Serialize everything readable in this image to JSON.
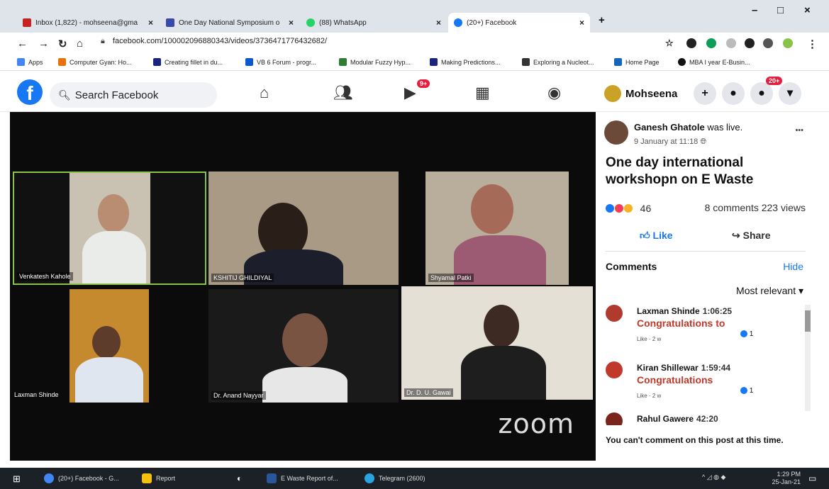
{
  "browser": {
    "tabs": [
      {
        "label": "Inbox (1,822) - mohseena@gma",
        "color": "#c5221f"
      },
      {
        "label": "One Day National Symposium o",
        "color": "#3949ab"
      },
      {
        "label": "(88) WhatsApp",
        "color": "#25d366"
      },
      {
        "label": "(20+) Facebook",
        "color": "#1877f2"
      }
    ],
    "new_tab": "+",
    "window": {
      "minimize": "–",
      "maximize": "□",
      "close": "×"
    },
    "url": "facebook.com/100002096880343/videos/3736471776432682/",
    "bookmarks": [
      {
        "label": "Apps",
        "color": "#4285f4"
      },
      {
        "label": "Computer Gyan: Ho...",
        "color": "#e8710a"
      },
      {
        "label": "Creating fillet in du...",
        "color": "#1a237e"
      },
      {
        "label": "VB 6 Forum - progr...",
        "color": "#0b57d0"
      },
      {
        "label": "Modular Fuzzy Hyp...",
        "color": "#2e7d32"
      },
      {
        "label": "Making Predictions...",
        "color": "#1a237e"
      },
      {
        "label": "Exploring a Nucleot...",
        "color": "#333333"
      },
      {
        "label": "Home Page",
        "color": "#1565c0"
      },
      {
        "label": "MBA I year E-Busin...",
        "color": "#111111"
      }
    ]
  },
  "facebook": {
    "search_placeholder": "Search Facebook",
    "watch_badge": "9+",
    "notif_badge": "20+",
    "profile_name": "Mohseena",
    "plus": "+"
  },
  "video": {
    "brand": "zoom",
    "participants": [
      {
        "name": "Venkatesh Kahole"
      },
      {
        "name": "KSHITIJ GHILDIYAL"
      },
      {
        "name": "Shyamal Patki"
      },
      {
        "name": "Laxman Shinde"
      },
      {
        "name": "Dr. Anand Nayyar"
      },
      {
        "name": "Dr. D. U. Gawai"
      }
    ]
  },
  "post": {
    "author": "Ganesh Ghatole",
    "author_suffix": "was live.",
    "time": "9 January at 11:18",
    "title": "One day international workshopn on E Waste",
    "reactions_count": "46",
    "stats": "8 comments 223 views",
    "like_label": "Like",
    "share_label": "Share",
    "more": "•••"
  },
  "comments": {
    "header": "Comments",
    "hide": "Hide",
    "sort": "Most relevant ▾",
    "items": [
      {
        "name": "Laxman Shinde",
        "time": "1:06:25",
        "text": "Congratulations to",
        "meta": "Like · 2 w",
        "reacts": "1",
        "avatar": "#b03a2e"
      },
      {
        "name": "Kiran Shillewar",
        "time": "1:59:44",
        "text": "Congratulations",
        "meta": "Like · 2 w",
        "reacts": "1",
        "avatar": "#c0392b"
      },
      {
        "name": "Rahul Gawere",
        "time": "42:20",
        "text": "",
        "meta": "",
        "reacts": "",
        "avatar": "#7b241c"
      }
    ],
    "cant_comment": "You can't comment on this post at this time."
  },
  "taskbar": {
    "items": [
      {
        "label": "(20+) Facebook - G...",
        "color": "#4285f4"
      },
      {
        "label": "Report",
        "color": "#f4c20d"
      },
      {
        "label": "E Waste Report of...",
        "color": "#2b579a"
      },
      {
        "label": "Telegram (2600)",
        "color": "#2aa3df"
      }
    ],
    "time": "1:29 PM",
    "date": "25-Jan-21"
  }
}
